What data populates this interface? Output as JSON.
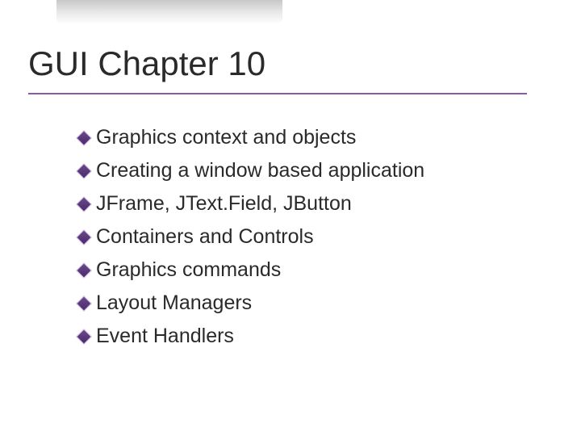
{
  "slide": {
    "title": "GUI Chapter 10",
    "bullets": [
      "Graphics context and objects",
      "Creating a window based application",
      "JFrame, JText.Field, JButton",
      "Containers and Controls",
      "Graphics commands",
      "Layout Managers",
      "Event Handlers"
    ]
  }
}
